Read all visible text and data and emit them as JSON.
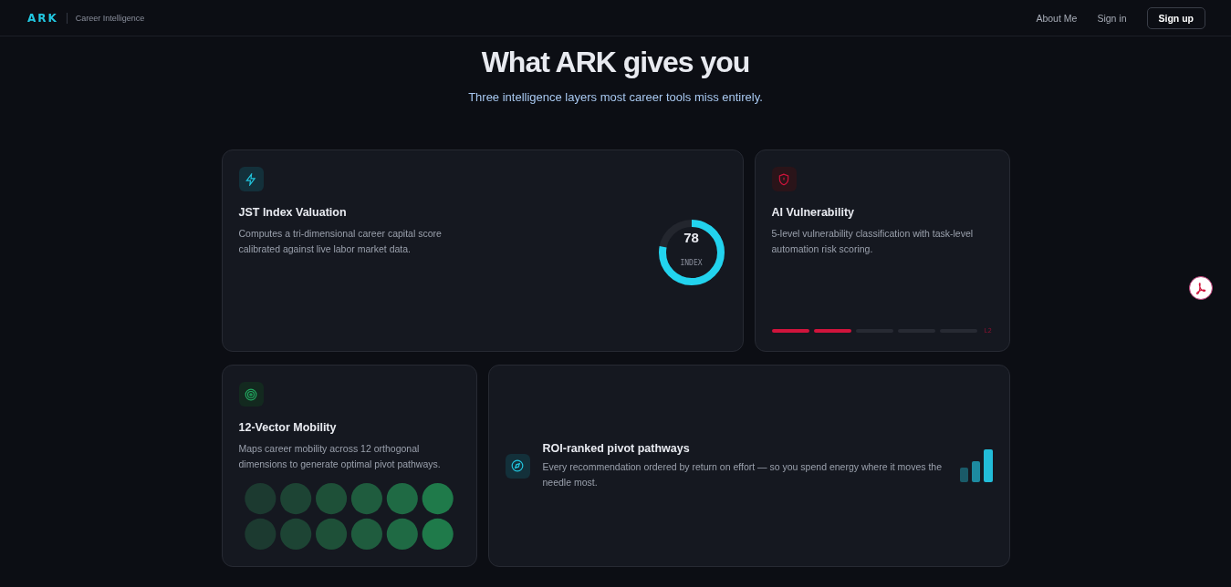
{
  "header": {
    "logo": "ARK",
    "tagline": "Career Intelligence",
    "nav": [
      {
        "label": "About Me",
        "kind": "link"
      },
      {
        "label": "Sign in",
        "kind": "link"
      },
      {
        "label": "Sign up",
        "kind": "button"
      }
    ]
  },
  "hero": {
    "title": "What ARK gives you",
    "subtitle": "Three intelligence layers most career tools miss entirely."
  },
  "cards": [
    {
      "kind": "gauge",
      "title": "JST Index Valuation",
      "text": "Computes a tri-dimensional career capital score calibrated against live labor market data.",
      "gauge": {
        "value": "78",
        "label": "INDEX",
        "level": 0.78
      }
    },
    {
      "kind": "segments",
      "title": "AI Vulnerability",
      "text": "5-level vulnerability classification with task-level automation risk scoring.",
      "segments": [
        {
          "on": true
        },
        {
          "on": true
        },
        {
          "on": false
        },
        {
          "on": false
        },
        {
          "on": false
        }
      ],
      "segment_label": "L2"
    },
    {
      "kind": "dots",
      "title": "12-Vector Mobility",
      "text": "Maps career mobility across 12 orthogonal dimensions to generate optimal pivot pathways."
    },
    {
      "kind": "bars",
      "title": "ROI-ranked pivot pathways",
      "text": "Every recommendation ordered by return on effort — so you spend energy where it moves the needle most."
    }
  ]
}
